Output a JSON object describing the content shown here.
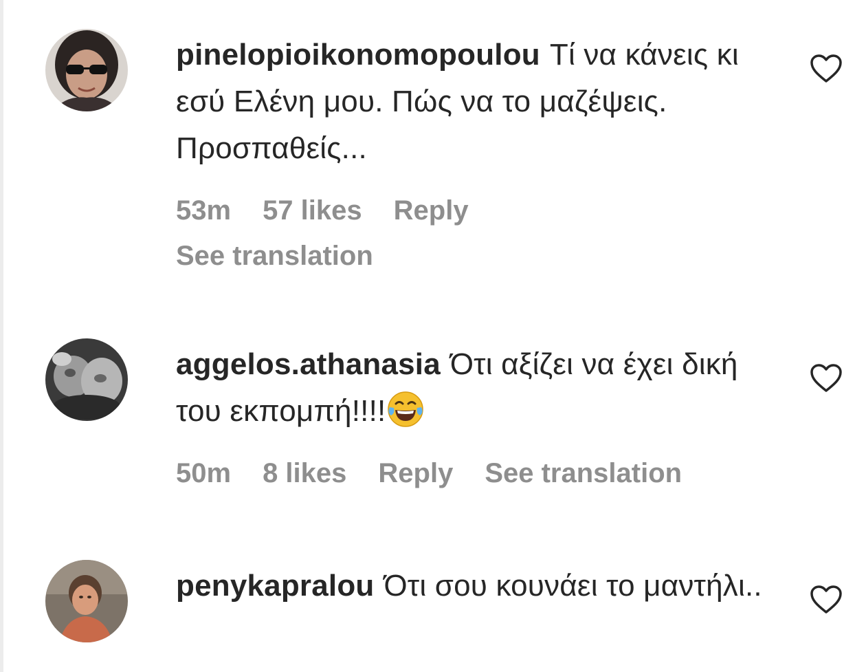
{
  "comments": [
    {
      "username": "pinelopioikonomopoulou",
      "text": "Τί να κάνεις κι εσύ Ελένη μου. Πώς να το μαζέψεις. Προσπαθείς...",
      "time": "53m",
      "likes": "57 likes",
      "reply": "Reply",
      "see_translation": "See translation",
      "like_icon": "heart-outline-icon"
    },
    {
      "username": "aggelos.athanasia",
      "text": "Ότι αξίζει να έχει δική του εκπομπή!!!!",
      "emoji": "😂",
      "time": "50m",
      "likes": "8 likes",
      "reply": "Reply",
      "see_translation": "See translation",
      "like_icon": "heart-outline-icon"
    },
    {
      "username": "penykapralou",
      "text": "Ότι σου κουνάει το μαντήλι..",
      "like_icon": "heart-outline-icon"
    }
  ]
}
